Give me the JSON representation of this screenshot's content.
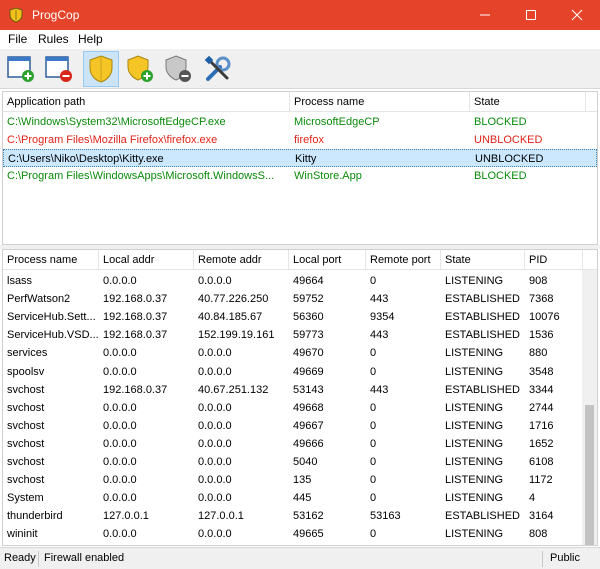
{
  "window": {
    "title": "ProgCop"
  },
  "menu": {
    "file": "File",
    "rules": "Rules",
    "help": "Help"
  },
  "toolbar": [
    {
      "name": "add-rule-button",
      "icon": "window-add-icon"
    },
    {
      "name": "remove-rule-button",
      "icon": "window-remove-icon"
    },
    {
      "name": "shield-button",
      "icon": "shield-icon",
      "active": true
    },
    {
      "name": "shield-add-button",
      "icon": "shield-add-icon"
    },
    {
      "name": "shield-remove-button",
      "icon": "shield-remove-icon"
    },
    {
      "name": "settings-button",
      "icon": "tools-icon"
    }
  ],
  "rules": {
    "columns": [
      "Application path",
      "Process name",
      "State"
    ],
    "rows": [
      {
        "path": "C:\\Windows\\System32\\MicrosoftEdgeCP.exe",
        "process": "MicrosoftEdgeCP",
        "state": "BLOCKED",
        "color": "#0a8a0a",
        "selected": false
      },
      {
        "path": "C:\\Program Files\\Mozilla Firefox\\firefox.exe",
        "process": "firefox",
        "state": "UNBLOCKED",
        "color": "#e0221a",
        "selected": false
      },
      {
        "path": "C:\\Users\\Niko\\Desktop\\Kitty.exe",
        "process": "Kitty",
        "state": "UNBLOCKED",
        "color": "#000000",
        "selected": true
      },
      {
        "path": "C:\\Program Files\\WindowsApps\\Microsoft.WindowsS...",
        "process": "WinStore.App",
        "state": "BLOCKED",
        "color": "#0a8a0a",
        "selected": false
      }
    ]
  },
  "connections": {
    "columns": [
      "Process name",
      "Local addr",
      "Remote addr",
      "Local port",
      "Remote port",
      "State",
      "PID"
    ],
    "rows": [
      [
        "lsass",
        "0.0.0.0",
        "0.0.0.0",
        "49664",
        "0",
        "LISTENING",
        "908"
      ],
      [
        "PerfWatson2",
        "192.168.0.37",
        "40.77.226.250",
        "59752",
        "443",
        "ESTABLISHED",
        "7368"
      ],
      [
        "ServiceHub.Sett...",
        "192.168.0.37",
        "40.84.185.67",
        "56360",
        "9354",
        "ESTABLISHED",
        "10076"
      ],
      [
        "ServiceHub.VSD...",
        "192.168.0.37",
        "152.199.19.161",
        "59773",
        "443",
        "ESTABLISHED",
        "1536"
      ],
      [
        "services",
        "0.0.0.0",
        "0.0.0.0",
        "49670",
        "0",
        "LISTENING",
        "880"
      ],
      [
        "spoolsv",
        "0.0.0.0",
        "0.0.0.0",
        "49669",
        "0",
        "LISTENING",
        "3548"
      ],
      [
        "svchost",
        "192.168.0.37",
        "40.67.251.132",
        "53143",
        "443",
        "ESTABLISHED",
        "3344"
      ],
      [
        "svchost",
        "0.0.0.0",
        "0.0.0.0",
        "49668",
        "0",
        "LISTENING",
        "2744"
      ],
      [
        "svchost",
        "0.0.0.0",
        "0.0.0.0",
        "49667",
        "0",
        "LISTENING",
        "1716"
      ],
      [
        "svchost",
        "0.0.0.0",
        "0.0.0.0",
        "49666",
        "0",
        "LISTENING",
        "1652"
      ],
      [
        "svchost",
        "0.0.0.0",
        "0.0.0.0",
        "5040",
        "0",
        "LISTENING",
        "6108"
      ],
      [
        "svchost",
        "0.0.0.0",
        "0.0.0.0",
        "135",
        "0",
        "LISTENING",
        "1172"
      ],
      [
        "System",
        "0.0.0.0",
        "0.0.0.0",
        "445",
        "0",
        "LISTENING",
        "4"
      ],
      [
        "thunderbird",
        "127.0.0.1",
        "127.0.0.1",
        "53162",
        "53163",
        "ESTABLISHED",
        "3164"
      ],
      [
        "wininit",
        "0.0.0.0",
        "0.0.0.0",
        "49665",
        "0",
        "LISTENING",
        "808"
      ]
    ]
  },
  "status": {
    "ready": "Ready",
    "firewall": "Firewall enabled",
    "profile": "Public"
  },
  "colors": {
    "titlebar": "#e5442a",
    "blocked": "#0a8a0a",
    "unblocked": "#e0221a",
    "selection": "#cce8ff"
  }
}
